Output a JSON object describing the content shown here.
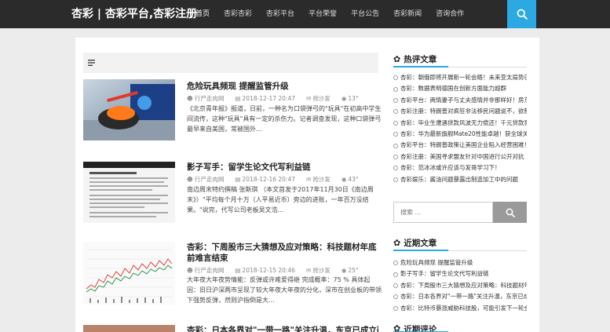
{
  "header": {
    "brand": "杏彩 | 杏彩平台,杏彩注册",
    "nav": [
      "首页",
      "杏彩杏彩",
      "杏彩平台",
      "平台荣誉",
      "平台公告",
      "杏彩新闻",
      "咨询合作"
    ]
  },
  "articles": [
    {
      "title": "危险玩具频现 提醒监管升级",
      "source": "行尸走肉网",
      "date": "2018-12-17 20:47",
      "author": "抢沙发",
      "views": "13°",
      "excerpt": "《北京青年报》报道，日前，一种名为口袋弹弓的\"玩具\"在初高中学生间流传，这种\"玩具\"具有一定的杀伤力。记者调查发现，这种口袋弹弓最早来自美国，常被国外..."
    },
    {
      "title": "影子写手：留学生论文代写利益链",
      "source": "行尸走肉网",
      "date": "2018-12-16 20:47",
      "author": "抢沙发",
      "views": "43°",
      "excerpt": "南边周末特约撰稿 张斯琪 （本文首发于2017年11月30日《南边周末》）\"平均每个月十万（人平易近币）旁边的进账，一年百万没结果。\"说完，代写公司老板吴文浩..."
    },
    {
      "title": "杏彩：下周股市三大猜想及应对策略：科技题材年底前难言结束",
      "source": "行尸走肉网",
      "date": "2018-12-15 20:46",
      "author": "抢沙发",
      "views": "25°",
      "excerpt": "大年夜大年夜势情能：反弹或许难爱得继 完成概率：75 % 具体起因：旧日沪深两市呈现了较大年夜大年夜的分化，深市在创业板的带领下强势反弹，然则沪指倒是大..."
    },
    {
      "title": "杏彩：日本各界对\"一带一路\"关注升温，东京已成立研究..."
    }
  ],
  "sidebar": {
    "hot_title": "热评文章",
    "hot": [
      "杏彩：朝俄即将开展新一轮会晤！未来亚太局势已",
      "杏彩：数据表明德国在创新方面能力超群",
      "杏彩平台：两情妻子与丈夫感情并非那样好！房东",
      "杏彩注册：特朗普对疯狂非法移民问题说不，欲制",
      "杏彩：毕业生遭遇贷款风波无力偿还！千元贷款竟",
      "杏彩：华为最新旗舰Mate20性能卓越！获全球关注",
      "杏彩平台：特朗普政策让美国企业陷入经营困难！",
      "杏彩注册：美国寻求盟友针对中国进行公开对抗",
      "杏彩：范冰冰或许应该与发哥学习下！",
      "杏彩娱乐：酱油问题暴露出制造加工中的问题"
    ],
    "search_placeholder": "搜索 ...",
    "recent_title": "近期文章",
    "recent": [
      "危险玩具频现 提醒监管升级",
      "影子写手：留学生论文代写利益链",
      "杏彩：下周股市三大猜想及应对策略：科技题材年",
      "杏彩：日本各界对\"一带一路\"关注升温，东京已成",
      "杏彩：比特币暴涨威胁科技股，可能引发下一轮金"
    ],
    "next_title": "近期评论"
  }
}
